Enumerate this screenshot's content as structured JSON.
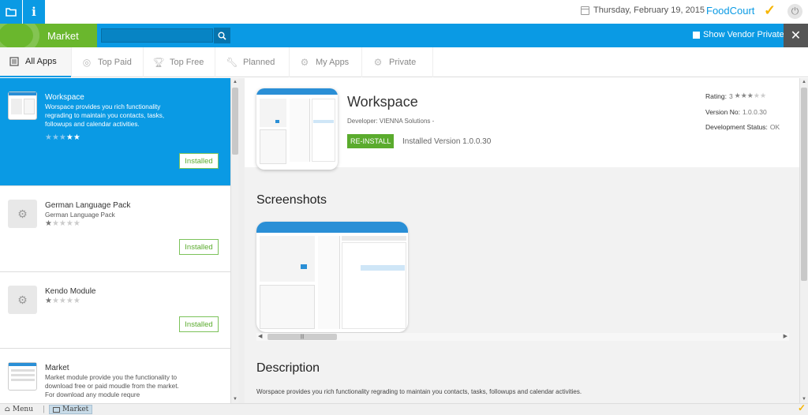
{
  "header": {
    "date": "Thursday, February 19, 2015",
    "brand": "FoodCourt",
    "brand_color": "#0a9ae4",
    "accent_color": "#f7b500"
  },
  "marketbar": {
    "title": "Market",
    "title_bg": "#6ab72d",
    "bar_bg": "#0a9ae4",
    "search_value": "",
    "vendor_private": "Show Vendor Private",
    "close_icon": "close-icon"
  },
  "tabs": [
    {
      "label": "All Apps",
      "icon": "list-icon"
    },
    {
      "label": "Top Paid",
      "icon": "coin-icon"
    },
    {
      "label": "Top Free",
      "icon": "trophy-icon"
    },
    {
      "label": "Planned",
      "icon": "wrench-icon"
    },
    {
      "label": "My Apps",
      "icon": "gear-plus-icon"
    },
    {
      "label": "Private",
      "icon": "gear-plus-icon"
    }
  ],
  "apps": [
    {
      "name": "Workspace",
      "desc": "Worspace provides you rich functionality regrading to maintain you contacts, tasks, followups and calendar activities.",
      "rating": 2,
      "status": "Installed",
      "thumb": "workspace-screenshot"
    },
    {
      "name": "German Language Pack",
      "desc": "German Language Pack",
      "rating": 1,
      "status": "Installed",
      "thumb": "gear-icon"
    },
    {
      "name": "Kendo Module",
      "desc": "",
      "rating": 1,
      "status": "Installed",
      "thumb": "gear-icon"
    },
    {
      "name": "Market",
      "desc": "Market module provide you the functionality to download free or paid moudle from the market. For download any module requre",
      "rating": 0,
      "status": "",
      "thumb": "market-screenshot"
    }
  ],
  "detail": {
    "title": "Workspace",
    "developer": "Developer: VIENNA Solutions -",
    "reinstall": "RE-INSTALL",
    "installed_version": "Installed Version 1.0.0.30",
    "rating_label": "Rating:",
    "rating_value": "3",
    "rating_stars": 3,
    "version_label": "Version No:",
    "version_value": "1.0.0.30",
    "dev_status_label": "Development Status:",
    "dev_status_value": "OK",
    "screenshots_heading": "Screenshots",
    "description_heading": "Description",
    "description": "Worspace provides you rich functionality regrading to maintain you contacts, tasks, followups and calendar activities."
  },
  "taskbar": {
    "menu": "Menu",
    "market": "Market"
  }
}
